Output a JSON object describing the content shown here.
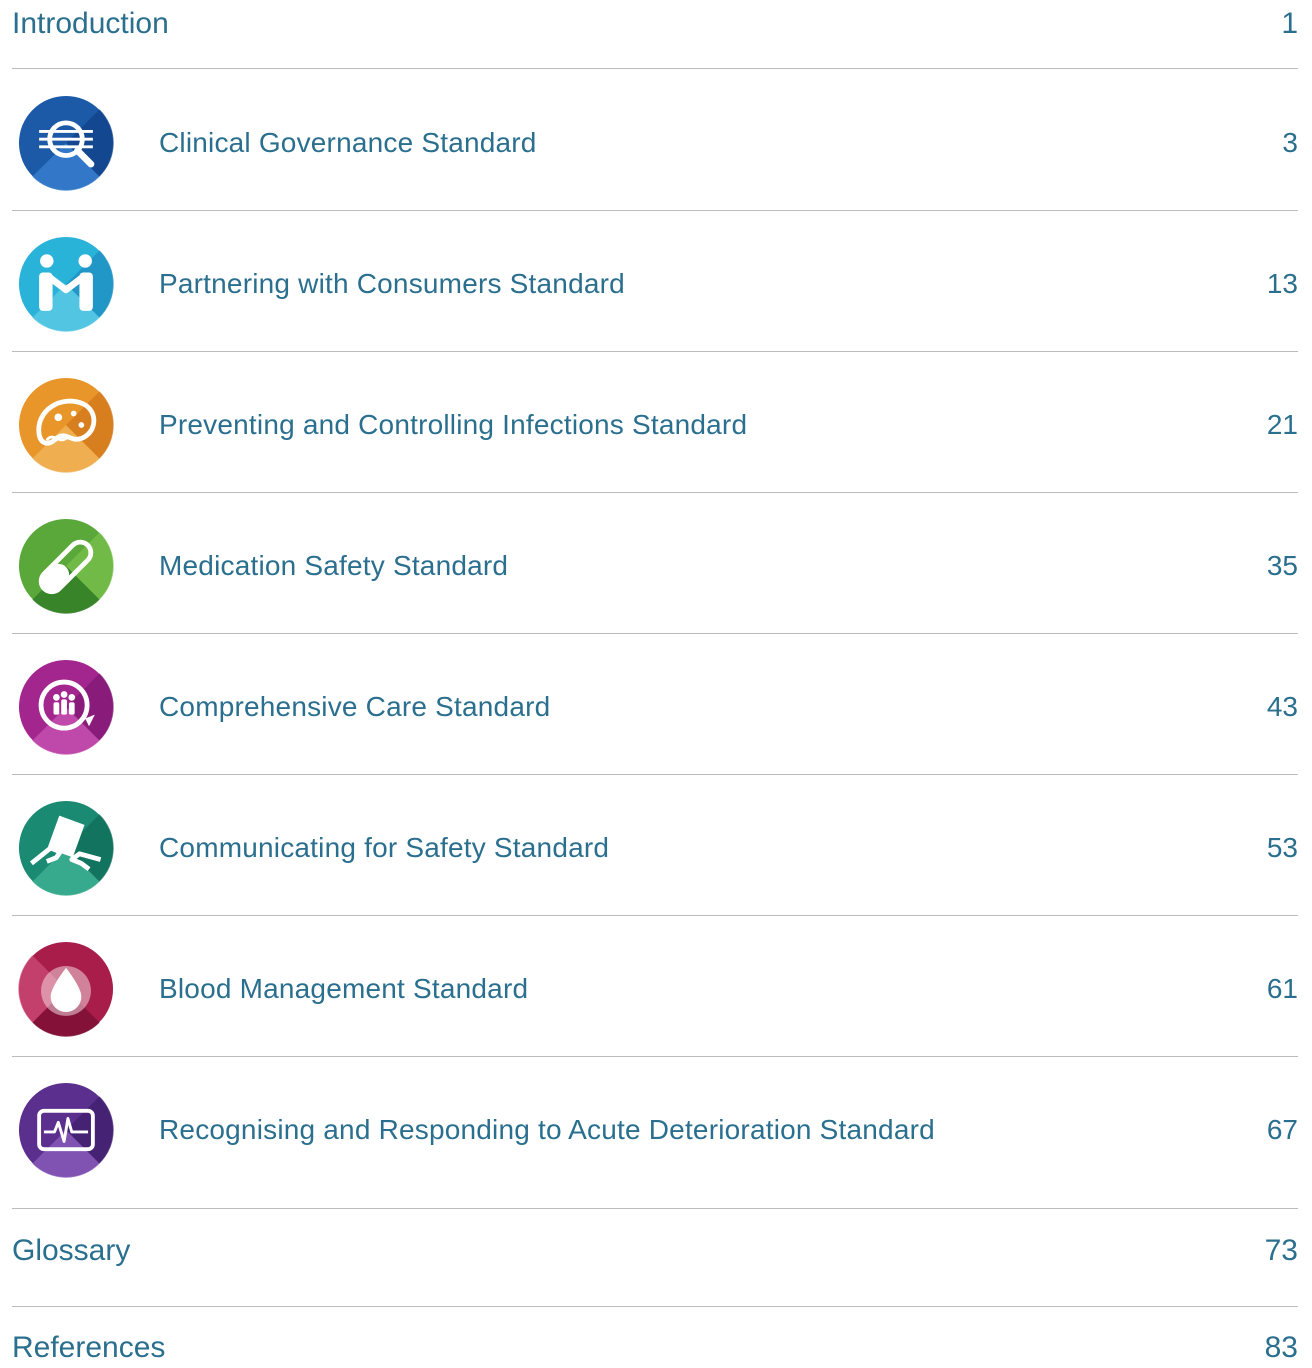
{
  "toc": {
    "introduction": {
      "label": "Introduction",
      "page": "1"
    },
    "standards": [
      {
        "label": "Clinical Governance Standard",
        "page": "3",
        "icon": "magnifier-document-icon",
        "color": "#1c5aa8"
      },
      {
        "label": "Partnering with Consumers Standard",
        "page": "13",
        "icon": "people-partnering-icon",
        "color": "#2ab3d8"
      },
      {
        "label": "Preventing and Controlling Infections Standard",
        "page": "21",
        "icon": "microbe-icon",
        "color": "#e8962a"
      },
      {
        "label": "Medication Safety Standard",
        "page": "35",
        "icon": "pill-capsule-icon",
        "color": "#5aa83a"
      },
      {
        "label": "Comprehensive Care Standard",
        "page": "43",
        "icon": "people-cycle-icon",
        "color": "#a3268f"
      },
      {
        "label": "Communicating for Safety Standard",
        "page": "53",
        "icon": "hand-document-icon",
        "color": "#1a8a72"
      },
      {
        "label": "Blood Management Standard",
        "page": "61",
        "icon": "blood-drop-icon",
        "color": "#a81d4a"
      },
      {
        "label": "Recognising and Responding to Acute Deterioration Standard",
        "page": "67",
        "icon": "heart-monitor-icon",
        "color": "#5b2f8e"
      }
    ],
    "glossary": {
      "label": "Glossary",
      "page": "73"
    },
    "references": {
      "label": "References",
      "page": "83"
    }
  }
}
